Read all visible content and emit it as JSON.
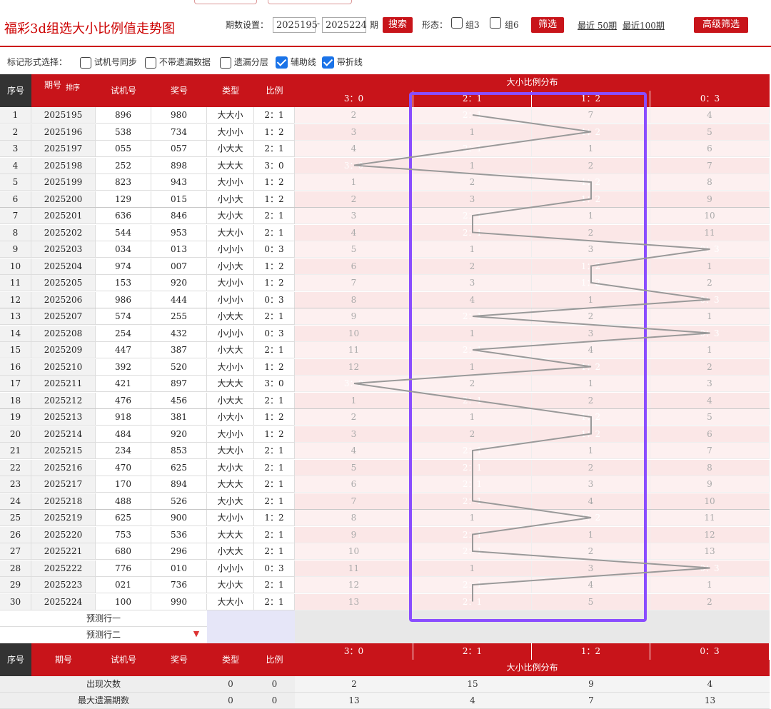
{
  "title": "福彩3d组选大小比例值走势图",
  "controls": {
    "period_label": "期数设置：",
    "start_period": "2025195",
    "dash": "-",
    "end_period": "2025224",
    "period_unit": "期",
    "search_label": "搜索",
    "form_label": "形态：",
    "group3_label": "组3",
    "group6_label": "组6",
    "filter_label": "筛选",
    "recent50_label": "最近 50期",
    "recent100_label": "最近100期",
    "advanced_label": "高级筛选"
  },
  "markbar": {
    "label": "标记形式选择：",
    "options": [
      {
        "label": "试机号同步",
        "checked": false
      },
      {
        "label": "不带遗漏数据",
        "checked": false
      },
      {
        "label": "遗漏分层",
        "checked": false
      },
      {
        "label": "辅助线",
        "checked": true
      },
      {
        "label": "带折线",
        "checked": true
      }
    ]
  },
  "headers": {
    "seq": "序号",
    "period": "期号",
    "sort": "排序",
    "trial": "试机号",
    "prize": "奖号",
    "type": "类型",
    "ratio": "比例",
    "dist_title": "大小比例分布",
    "dist_cols": [
      "3：0",
      "2：1",
      "1：2",
      "0：3"
    ]
  },
  "rows": [
    {
      "seq": "1",
      "period": "2025195",
      "trial": "896",
      "prize": "980",
      "type": "大大小",
      "ratio": "2：1",
      "hit": 1,
      "cells": [
        "2",
        "2：1",
        "7",
        "4"
      ]
    },
    {
      "seq": "2",
      "period": "2025196",
      "trial": "538",
      "prize": "734",
      "type": "大小小",
      "ratio": "1：2",
      "hit": 2,
      "cells": [
        "3",
        "1",
        "1：2",
        "5"
      ]
    },
    {
      "seq": "3",
      "period": "2025197",
      "trial": "055",
      "prize": "057",
      "type": "小大大",
      "ratio": "2：1",
      "hit": 1,
      "cells": [
        "4",
        "2：1",
        "1",
        "6"
      ]
    },
    {
      "seq": "4",
      "period": "2025198",
      "trial": "252",
      "prize": "898",
      "type": "大大大",
      "ratio": "3：0",
      "hit": 0,
      "cells": [
        "3：0",
        "1",
        "2",
        "7"
      ]
    },
    {
      "seq": "5",
      "period": "2025199",
      "trial": "823",
      "prize": "943",
      "type": "大小小",
      "ratio": "1：2",
      "hit": 2,
      "cells": [
        "1",
        "2",
        "1：2",
        "8"
      ]
    },
    {
      "seq": "6",
      "period": "2025200",
      "trial": "129",
      "prize": "015",
      "type": "小小大",
      "ratio": "1：2",
      "hit": 2,
      "cells": [
        "2",
        "3",
        "1：2",
        "9"
      ]
    },
    {
      "seq": "7",
      "period": "2025201",
      "trial": "636",
      "prize": "846",
      "type": "大小大",
      "ratio": "2：1",
      "hit": 1,
      "cells": [
        "3",
        "2：1",
        "1",
        "10"
      ]
    },
    {
      "seq": "8",
      "period": "2025202",
      "trial": "544",
      "prize": "953",
      "type": "大大小",
      "ratio": "2：1",
      "hit": 1,
      "cells": [
        "4",
        "2：1",
        "2",
        "11"
      ]
    },
    {
      "seq": "9",
      "period": "2025203",
      "trial": "034",
      "prize": "013",
      "type": "小小小",
      "ratio": "0：3",
      "hit": 3,
      "cells": [
        "5",
        "1",
        "3",
        "0：3"
      ]
    },
    {
      "seq": "10",
      "period": "2025204",
      "trial": "974",
      "prize": "007",
      "type": "小小大",
      "ratio": "1：2",
      "hit": 2,
      "cells": [
        "6",
        "2",
        "1：2",
        "1"
      ]
    },
    {
      "seq": "11",
      "period": "2025205",
      "trial": "153",
      "prize": "920",
      "type": "大小小",
      "ratio": "1：2",
      "hit": 2,
      "cells": [
        "7",
        "3",
        "1：2",
        "2"
      ]
    },
    {
      "seq": "12",
      "period": "2025206",
      "trial": "986",
      "prize": "444",
      "type": "小小小",
      "ratio": "0：3",
      "hit": 3,
      "cells": [
        "8",
        "4",
        "1",
        "0：3"
      ]
    },
    {
      "seq": "13",
      "period": "2025207",
      "trial": "574",
      "prize": "255",
      "type": "小大大",
      "ratio": "2：1",
      "hit": 1,
      "cells": [
        "9",
        "2：1",
        "2",
        "1"
      ]
    },
    {
      "seq": "14",
      "period": "2025208",
      "trial": "254",
      "prize": "432",
      "type": "小小小",
      "ratio": "0：3",
      "hit": 3,
      "cells": [
        "10",
        "1",
        "3",
        "0：3"
      ]
    },
    {
      "seq": "15",
      "period": "2025209",
      "trial": "447",
      "prize": "387",
      "type": "小大大",
      "ratio": "2：1",
      "hit": 1,
      "cells": [
        "11",
        "2：1",
        "4",
        "1"
      ]
    },
    {
      "seq": "16",
      "period": "2025210",
      "trial": "392",
      "prize": "520",
      "type": "大小小",
      "ratio": "1：2",
      "hit": 2,
      "cells": [
        "12",
        "1",
        "1：2",
        "2"
      ]
    },
    {
      "seq": "17",
      "period": "2025211",
      "trial": "421",
      "prize": "897",
      "type": "大大大",
      "ratio": "3：0",
      "hit": 0,
      "cells": [
        "3：0",
        "2",
        "1",
        "3"
      ]
    },
    {
      "seq": "18",
      "period": "2025212",
      "trial": "476",
      "prize": "456",
      "type": "小大大",
      "ratio": "2：1",
      "hit": 1,
      "cells": [
        "1",
        "2：1",
        "2",
        "4"
      ]
    },
    {
      "seq": "19",
      "period": "2025213",
      "trial": "918",
      "prize": "381",
      "type": "小大小",
      "ratio": "1：2",
      "hit": 2,
      "cells": [
        "2",
        "1",
        "1：2",
        "5"
      ]
    },
    {
      "seq": "20",
      "period": "2025214",
      "trial": "484",
      "prize": "920",
      "type": "大小小",
      "ratio": "1：2",
      "hit": 2,
      "cells": [
        "3",
        "2",
        "1：2",
        "6"
      ]
    },
    {
      "seq": "21",
      "period": "2025215",
      "trial": "234",
      "prize": "853",
      "type": "大大小",
      "ratio": "2：1",
      "hit": 1,
      "cells": [
        "4",
        "2：1",
        "1",
        "7"
      ]
    },
    {
      "seq": "22",
      "period": "2025216",
      "trial": "470",
      "prize": "625",
      "type": "大小大",
      "ratio": "2：1",
      "hit": 1,
      "cells": [
        "5",
        "2：1",
        "2",
        "8"
      ]
    },
    {
      "seq": "23",
      "period": "2025217",
      "trial": "170",
      "prize": "894",
      "type": "大大大",
      "ratio": "2：1",
      "hit": 1,
      "cells": [
        "6",
        "2：1",
        "3",
        "9"
      ]
    },
    {
      "seq": "24",
      "period": "2025218",
      "trial": "488",
      "prize": "526",
      "type": "大小大",
      "ratio": "2：1",
      "hit": 1,
      "cells": [
        "7",
        "2：1",
        "4",
        "10"
      ]
    },
    {
      "seq": "25",
      "period": "2025219",
      "trial": "625",
      "prize": "900",
      "type": "大小小",
      "ratio": "1：2",
      "hit": 2,
      "cells": [
        "8",
        "1",
        "1：2",
        "11"
      ]
    },
    {
      "seq": "26",
      "period": "2025220",
      "trial": "753",
      "prize": "536",
      "type": "大大大",
      "ratio": "2：1",
      "hit": 1,
      "cells": [
        "9",
        "2：1",
        "1",
        "12"
      ]
    },
    {
      "seq": "27",
      "period": "2025221",
      "trial": "680",
      "prize": "296",
      "type": "小大大",
      "ratio": "2：1",
      "hit": 1,
      "cells": [
        "10",
        "2：1",
        "2",
        "13"
      ]
    },
    {
      "seq": "28",
      "period": "2025222",
      "trial": "776",
      "prize": "010",
      "type": "小小小",
      "ratio": "0：3",
      "hit": 3,
      "cells": [
        "11",
        "1",
        "3",
        "0：3"
      ]
    },
    {
      "seq": "29",
      "period": "2025223",
      "trial": "021",
      "prize": "736",
      "type": "大小大",
      "ratio": "2：1",
      "hit": 1,
      "cells": [
        "12",
        "2：1",
        "4",
        "1"
      ]
    },
    {
      "seq": "30",
      "period": "2025224",
      "trial": "100",
      "prize": "990",
      "type": "大大小",
      "ratio": "2：1",
      "hit": 1,
      "cells": [
        "13",
        "2：1",
        "5",
        "2"
      ]
    }
  ],
  "prediction": {
    "row1": "预测行一",
    "row2": "预测行二"
  },
  "footer": {
    "appear_label": "出现次数",
    "appear_type": "0",
    "appear_ratio": "0",
    "appear_values": [
      "2",
      "15",
      "9",
      "4"
    ],
    "maxmiss_label": "最大遗漏期数",
    "maxmiss_type": "0",
    "maxmiss_ratio": "0",
    "maxmiss_values": [
      "13",
      "4",
      "7",
      "13"
    ]
  },
  "colors": {
    "accent": "#c8141a",
    "highlight": "#8a4dff",
    "checkbox": "#1a73e8"
  }
}
